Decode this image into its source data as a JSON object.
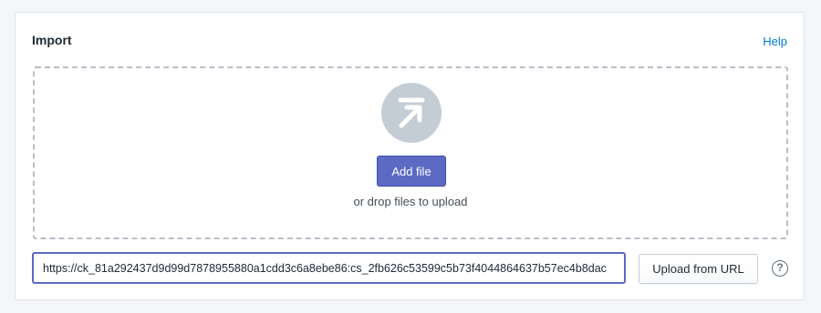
{
  "import": {
    "title": "Import",
    "help_label": "Help",
    "dropzone": {
      "upload_icon": "upload-arrow-icon",
      "add_file_label": "Add file",
      "hint": "or drop files to upload"
    },
    "url_input": {
      "value": "https://ck_81a292437d9d99d7878955880a1cdd3c6a8ebe86:cs_2fb626c53599c5b73f4044864637b57ec4b8dac"
    },
    "upload_url_label": "Upload from URL",
    "info_icon": "question-mark-icon",
    "info_glyph": "?"
  },
  "colors": {
    "accent": "#5c6ac4",
    "link": "#007ace",
    "icon_circle": "#c4cdd5"
  }
}
